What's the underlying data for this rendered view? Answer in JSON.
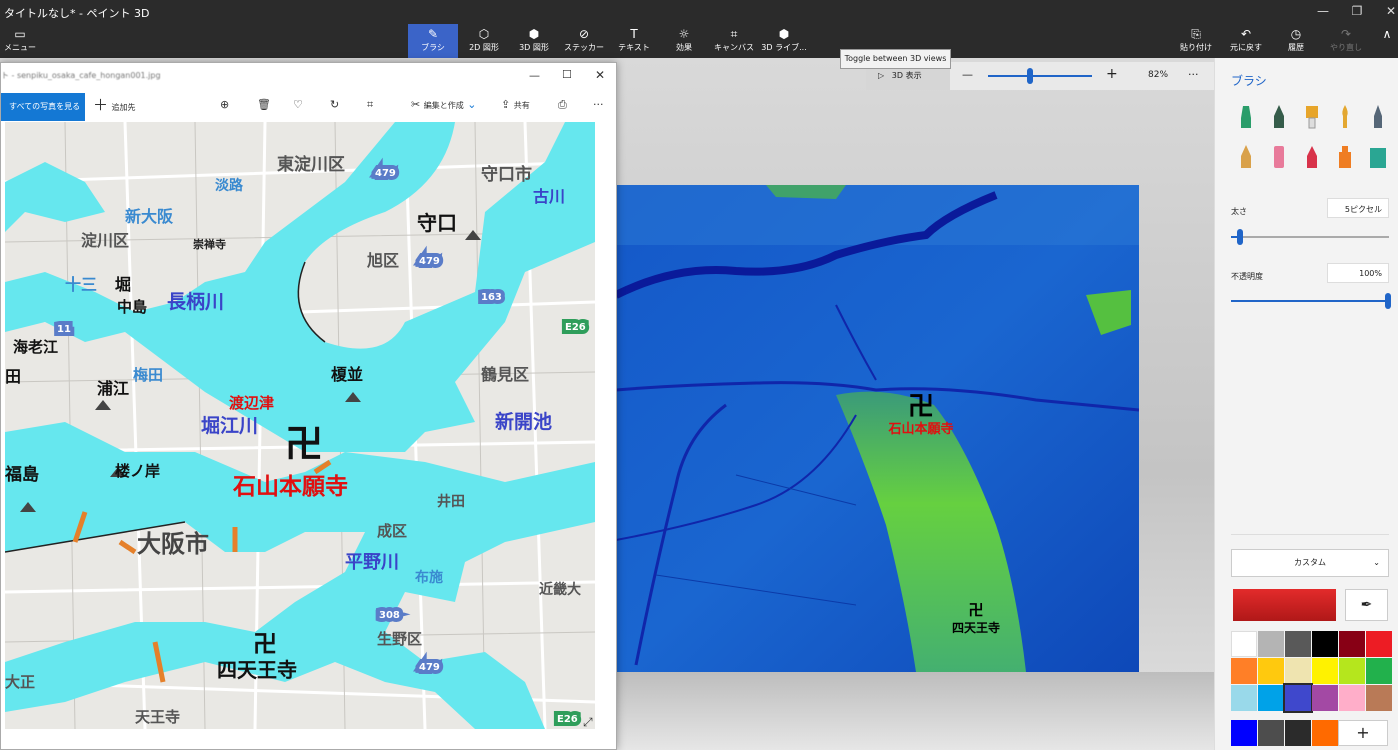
{
  "app": {
    "title": "タイトルなし* - ペイント 3D",
    "minimize_glyph": "—",
    "maximize_glyph": "❐",
    "close_glyph": "✕"
  },
  "ribbon": {
    "menu_label": "メニュー",
    "tools": [
      {
        "label": "ブラシ",
        "icon": "brush-icon",
        "glyph": "✎"
      },
      {
        "label": "2D 図形",
        "icon": "2d-shapes-icon",
        "glyph": "⬡"
      },
      {
        "label": "3D 図形",
        "icon": "3d-shapes-icon",
        "glyph": "⬢"
      },
      {
        "label": "ステッカー",
        "icon": "sticker-icon",
        "glyph": "⊘"
      },
      {
        "label": "テキスト",
        "icon": "text-icon",
        "glyph": "T"
      },
      {
        "label": "効果",
        "icon": "effects-icon",
        "glyph": "☼"
      },
      {
        "label": "キャンバス",
        "icon": "canvas-icon",
        "glyph": "⌗"
      },
      {
        "label": "3D ライブ...",
        "icon": "3d-library-icon",
        "glyph": "⬢"
      }
    ],
    "right": [
      {
        "label": "貼り付け",
        "icon": "paste-icon",
        "glyph": "⎘"
      },
      {
        "label": "元に戻す",
        "icon": "undo-icon",
        "glyph": "↶"
      },
      {
        "label": "履歴",
        "icon": "history-icon",
        "glyph": "◷"
      },
      {
        "label": "やり直し",
        "icon": "redo-icon",
        "glyph": "↷"
      }
    ],
    "collapse_glyph": "∧"
  },
  "tooltip": "Toggle between 3D views",
  "viewbar": {
    "view3d_label": "3D 表示",
    "zoom_minus": "—",
    "zoom_plus": "+",
    "zoom_value": "82%",
    "more": "···",
    "zoom_fraction": 0.4
  },
  "sidebar": {
    "title": "ブラシ",
    "thickness_label": "太さ",
    "thickness_value": "5ピクセル",
    "opacity_label": "不透明度",
    "opacity_value": "100%",
    "color_mode": "カスタム",
    "eyedropper_glyph": "✒",
    "add_color_glyph": "+",
    "tools": [
      {
        "name": "marker",
        "color": "#2a9d6a"
      },
      {
        "name": "calligraphy-pen",
        "color": "#355c4a"
      },
      {
        "name": "oil-brush",
        "color": "#e7a52a"
      },
      {
        "name": "watercolor",
        "color": "#e3a730"
      },
      {
        "name": "pixel-pen",
        "color": "#556677"
      },
      {
        "name": "pencil",
        "color": "#d9a14a"
      },
      {
        "name": "eraser",
        "color": "#e87a9a"
      },
      {
        "name": "crayon",
        "color": "#d8324a"
      },
      {
        "name": "spray-can",
        "color": "#ef7d22"
      },
      {
        "name": "fill",
        "color": "#2aa693"
      }
    ],
    "palette": [
      "#ffffff",
      "#b4b4b4",
      "#595959",
      "#000000",
      "#880015",
      "#ed1c24",
      "#ff7f27",
      "#ffc90e",
      "#efe4b0",
      "#fff200",
      "#b5e61d",
      "#22b14c",
      "#99d9ea",
      "#00a2e8",
      "#3f48cc",
      "#a349a4",
      "#ffaec9",
      "#b97a57",
      "#0000ff",
      "#4d4d4d",
      "#2b2b2b",
      "#ff6a00"
    ]
  },
  "photos": {
    "title": "ト - senpiku_osaka_cafe_hongan001.jpg",
    "all_photos": "すべての写真を見る",
    "add_to": "追加先",
    "edit_create": "編集と作成",
    "share": "共有",
    "minimize_glyph": "—",
    "maximize_glyph": "☐",
    "close_glyph": "✕"
  },
  "map2d": {
    "labels": [
      "東淀川区",
      "淡路",
      "守口市",
      "新大阪",
      "淀川区",
      "崇禅寺",
      "守口",
      "古川",
      "十三",
      "堀",
      "中島",
      "長柄川",
      "旭区",
      "海老江",
      "梅田",
      "田",
      "浦江",
      "榎並",
      "鶴見区",
      "渡辺津",
      "堀江川",
      "新開池",
      "福島",
      "楼ノ岸",
      "石山本願寺",
      "大阪市",
      "平野川",
      "成区",
      "井田",
      "近畿大",
      "布施",
      "四天王寺",
      "大正",
      "生野区",
      "天王寺",
      "卍",
      "卍",
      "E26",
      "E26",
      "479",
      "479",
      "479",
      "308",
      "11",
      "163"
    ]
  },
  "map3d": {
    "labels": [
      "石山本願寺",
      "四天王寺",
      "卍",
      "卍"
    ]
  }
}
